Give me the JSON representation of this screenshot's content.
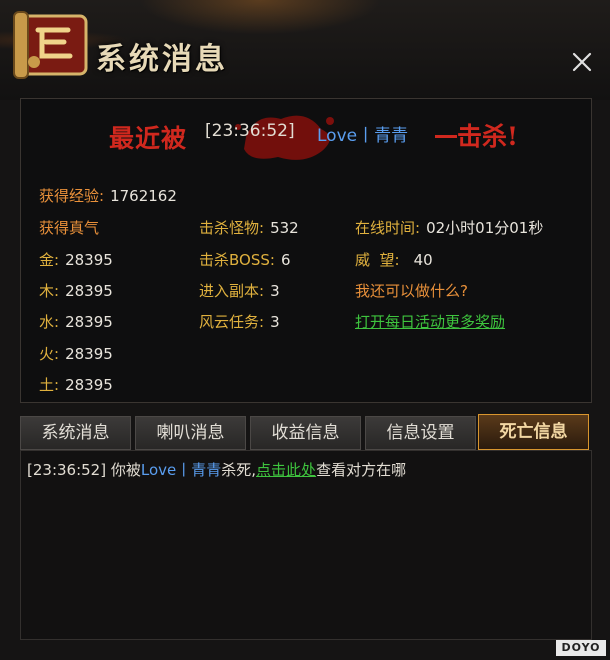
{
  "window": {
    "title": "系统消息",
    "close_icon": "close-icon"
  },
  "banner": {
    "prefix": "最近被",
    "time": "[23:36:52]",
    "killer": "Love丨青青",
    "suffix": "击杀!"
  },
  "stats": {
    "exp": {
      "label": "获得经验:",
      "value": "1762162"
    },
    "qi": {
      "label": "获得真气",
      "value": ""
    },
    "gold": {
      "label": "金:",
      "value": "28395"
    },
    "wood": {
      "label": "木:",
      "value": "28395"
    },
    "water": {
      "label": "水:",
      "value": "28395"
    },
    "fire": {
      "label": "火:",
      "value": "28395"
    },
    "earth": {
      "label": "土:",
      "value": "28395"
    },
    "monsters": {
      "label": "击杀怪物:",
      "value": "532"
    },
    "boss": {
      "label": "击杀BOSS:",
      "value": "6"
    },
    "dungeon": {
      "label": "进入副本:",
      "value": "3"
    },
    "quest": {
      "label": "风云任务:",
      "value": "3"
    },
    "online": {
      "label": "在线时间:",
      "value": "02小时01分01秒"
    },
    "prestige": {
      "label": "威  望:",
      "value": "40"
    },
    "what_else": "我还可以做什么?",
    "daily_link": "打开每日活动更多奖励"
  },
  "tabs": [
    {
      "label": "系统消息",
      "active": false
    },
    {
      "label": "喇叭消息",
      "active": false
    },
    {
      "label": "收益信息",
      "active": false
    },
    {
      "label": "信息设置",
      "active": false
    },
    {
      "label": "死亡信息",
      "active": true
    }
  ],
  "log": {
    "time": "[23:36:52]",
    "text1": "你被",
    "killer": "Love丨青青",
    "text2": "杀死,",
    "link": "点击此处",
    "text3": "查看对方在哪"
  },
  "watermark": "DOYO",
  "colors": {
    "red": "#d0281e",
    "blue_name": "#5a9ef0",
    "gold_label": "#e0b13e",
    "orange_label": "#e8903a",
    "green_link": "#3ec43e",
    "active_tab_border": "#d9962e"
  }
}
